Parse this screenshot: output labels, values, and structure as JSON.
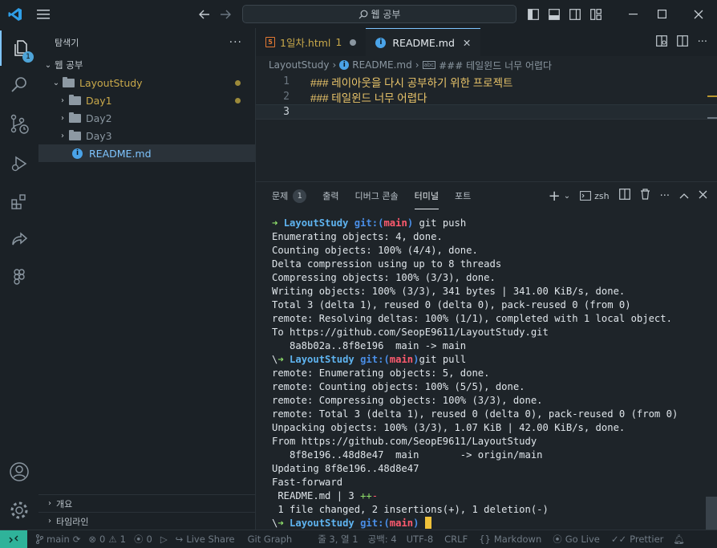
{
  "titlebar": {
    "search_text": "웹 공부"
  },
  "activity": {
    "explorer_badge": "1"
  },
  "sidebar": {
    "title": "탐색기",
    "workspace": "웹 공부",
    "root_folder": "LayoutStudy",
    "items": [
      {
        "label": "Day1",
        "color": "#c8a84a"
      },
      {
        "label": "Day2",
        "color": "#8a96a0"
      },
      {
        "label": "Day3",
        "color": "#8a96a0"
      },
      {
        "label": "README.md",
        "color": "#7fc5ff"
      }
    ],
    "outline_label": "개요",
    "timeline_label": "타임라인"
  },
  "tabs": [
    {
      "label": "1일차.html",
      "count": "1"
    },
    {
      "label": "README.md"
    }
  ],
  "breadcrumb": {
    "folder": "LayoutStudy",
    "file": "README.md",
    "symbol": "### 테일윈드 너무 어렵다"
  },
  "editor": {
    "lines": [
      {
        "num": "1",
        "text": "### 레이아웃을 다시 공부하기 위한 프로젝트"
      },
      {
        "num": "2",
        "text": "### 테일윈드 너무 어렵다"
      },
      {
        "num": "3",
        "text": ""
      }
    ]
  },
  "panel": {
    "tabs": [
      "문제",
      "출력",
      "디버그 콘솔",
      "터미널",
      "포트"
    ],
    "problems_count": "1",
    "shell": "zsh"
  },
  "terminal": {
    "prompt_dir": "LayoutStudy",
    "git_label": "git:",
    "branch_open": "(",
    "branch": "main",
    "branch_close": ")",
    "cmd1": "git push",
    "cmd2": "git pull",
    "prefix3": "\\",
    "out1": [
      "Enumerating objects: 4, done.",
      "Counting objects: 100% (4/4), done.",
      "Delta compression using up to 8 threads",
      "Compressing objects: 100% (3/3), done.",
      "Writing objects: 100% (3/3), 341 bytes | 341.00 KiB/s, done.",
      "Total 3 (delta 1), reused 0 (delta 0), pack-reused 0 (from 0)",
      "remote: Resolving deltas: 100% (1/1), completed with 1 local object.",
      "To https://github.com/SeopE9611/LayoutStudy.git",
      "   8a8b02a..8f8e196  main -> main"
    ],
    "out2": [
      "remote: Enumerating objects: 5, done.",
      "remote: Counting objects: 100% (5/5), done.",
      "remote: Compressing objects: 100% (3/3), done.",
      "remote: Total 3 (delta 1), reused 0 (delta 0), pack-reused 0 (from 0)",
      "Unpacking objects: 100% (3/3), 1.07 KiB | 42.00 KiB/s, done.",
      "From https://github.com/SeopE9611/LayoutStudy",
      "   8f8e196..48d8e47  main       -> origin/main",
      "Updating 8f8e196..48d8e47",
      "Fast-forward"
    ],
    "stat_file": " README.md | 3 ",
    "stat_plus": "++",
    "stat_minus": "-",
    "summary": " 1 file changed, 2 insertions(+), 1 deletion(-)"
  },
  "statusbar": {
    "branch": "main",
    "errors": "0",
    "warnings": "1",
    "ports": "0",
    "live_share": "Live Share",
    "git_graph": "Git Graph",
    "position": "줄 3, 열 1",
    "spaces": "공백: 4",
    "encoding": "UTF-8",
    "eol": "CRLF",
    "language": "Markdown",
    "go_live": "Go Live",
    "prettier": "Prettier"
  }
}
